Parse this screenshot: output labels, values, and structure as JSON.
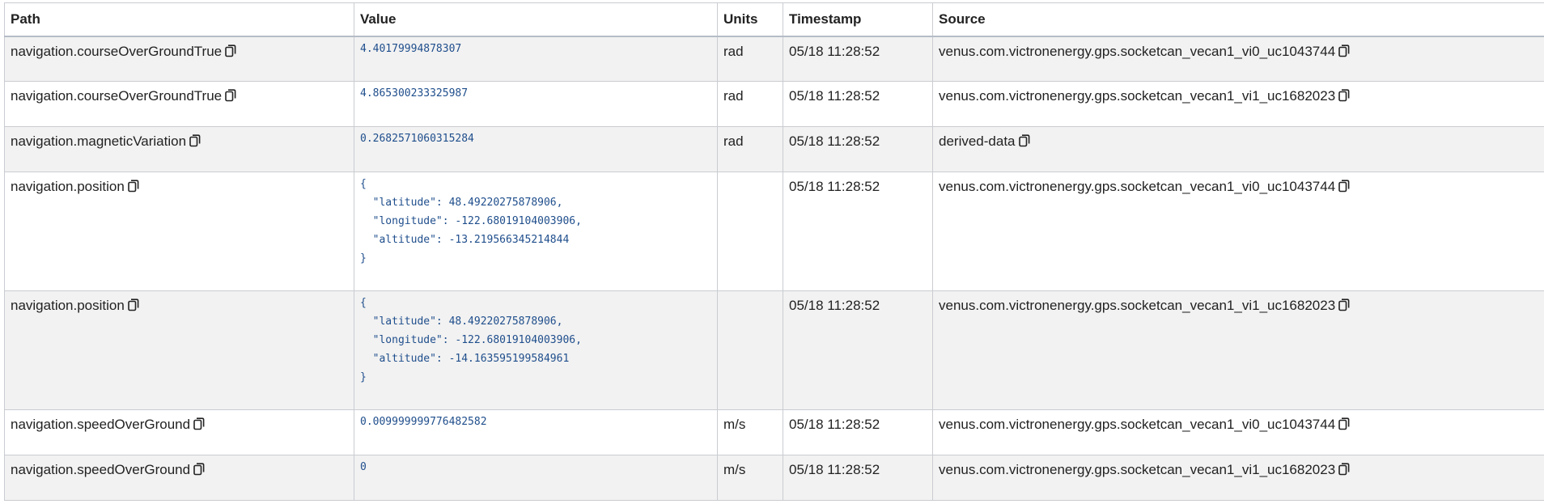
{
  "headers": {
    "path": "Path",
    "value": "Value",
    "units": "Units",
    "timestamp": "Timestamp",
    "source": "Source"
  },
  "rows": [
    {
      "path": "navigation.courseOverGroundTrue",
      "value": "4.40179994878307",
      "units": "rad",
      "timestamp": "05/18 11:28:52",
      "source": "venus.com.victronenergy.gps.socketcan_vecan1_vi0_uc1043744"
    },
    {
      "path": "navigation.courseOverGroundTrue",
      "value": "4.865300233325987",
      "units": "rad",
      "timestamp": "05/18 11:28:52",
      "source": "venus.com.victronenergy.gps.socketcan_vecan1_vi1_uc1682023"
    },
    {
      "path": "navigation.magneticVariation",
      "value": "0.2682571060315284",
      "units": "rad",
      "timestamp": "05/18 11:28:52",
      "source": "derived-data"
    },
    {
      "path": "navigation.position",
      "value": "{\n  \"latitude\": 48.49220275878906,\n  \"longitude\": -122.68019104003906,\n  \"altitude\": -13.219566345214844\n}",
      "units": "",
      "timestamp": "05/18 11:28:52",
      "source": "venus.com.victronenergy.gps.socketcan_vecan1_vi0_uc1043744"
    },
    {
      "path": "navigation.position",
      "value": "{\n  \"latitude\": 48.49220275878906,\n  \"longitude\": -122.68019104003906,\n  \"altitude\": -14.163595199584961\n}",
      "units": "",
      "timestamp": "05/18 11:28:52",
      "source": "venus.com.victronenergy.gps.socketcan_vecan1_vi1_uc1682023"
    },
    {
      "path": "navigation.speedOverGround",
      "value": "0.009999999776482582",
      "units": "m/s",
      "timestamp": "05/18 11:28:52",
      "source": "venus.com.victronenergy.gps.socketcan_vecan1_vi0_uc1043744"
    },
    {
      "path": "navigation.speedOverGround",
      "value": "0",
      "units": "m/s",
      "timestamp": "05/18 11:28:52",
      "source": "venus.com.victronenergy.gps.socketcan_vecan1_vi1_uc1682023"
    }
  ],
  "icons": {
    "copy": "copy-icon"
  },
  "colors": {
    "value_text": "#1f4e8c",
    "row_shaded": "#f2f2f2",
    "border": "#c9ccd1"
  }
}
